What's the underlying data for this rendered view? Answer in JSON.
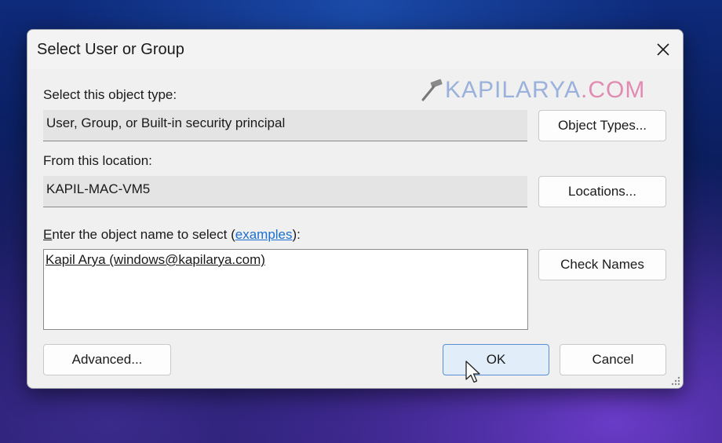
{
  "dialog": {
    "title": "Select User or Group",
    "close_icon": "close-icon"
  },
  "watermark": {
    "icon": "hammer-icon",
    "text_main": "KAPILARYA",
    "text_tail": ".COM",
    "colors": {
      "main": "#8aa6d8",
      "tail": "#e07aa6"
    }
  },
  "object_type": {
    "label": "Select this object type:",
    "value": "User, Group, or Built-in security principal",
    "button": "Object Types..."
  },
  "location": {
    "label": "From this location:",
    "value": "KAPIL-MAC-VM5",
    "button": "Locations..."
  },
  "object_name": {
    "label_accel": "E",
    "label_prefix": "nter the object name to select (",
    "label_link": "examples",
    "label_suffix": "):",
    "value": "Kapil Arya (windows@kapilarya.com)",
    "check_button": "Check Names"
  },
  "footer": {
    "advanced_button": "Advanced...",
    "ok_button": "OK",
    "cancel_button": "Cancel"
  },
  "colors": {
    "link": "#1a6fd0",
    "primary_button_bg": "#e1edf8",
    "primary_button_border": "#5b8fd4"
  }
}
